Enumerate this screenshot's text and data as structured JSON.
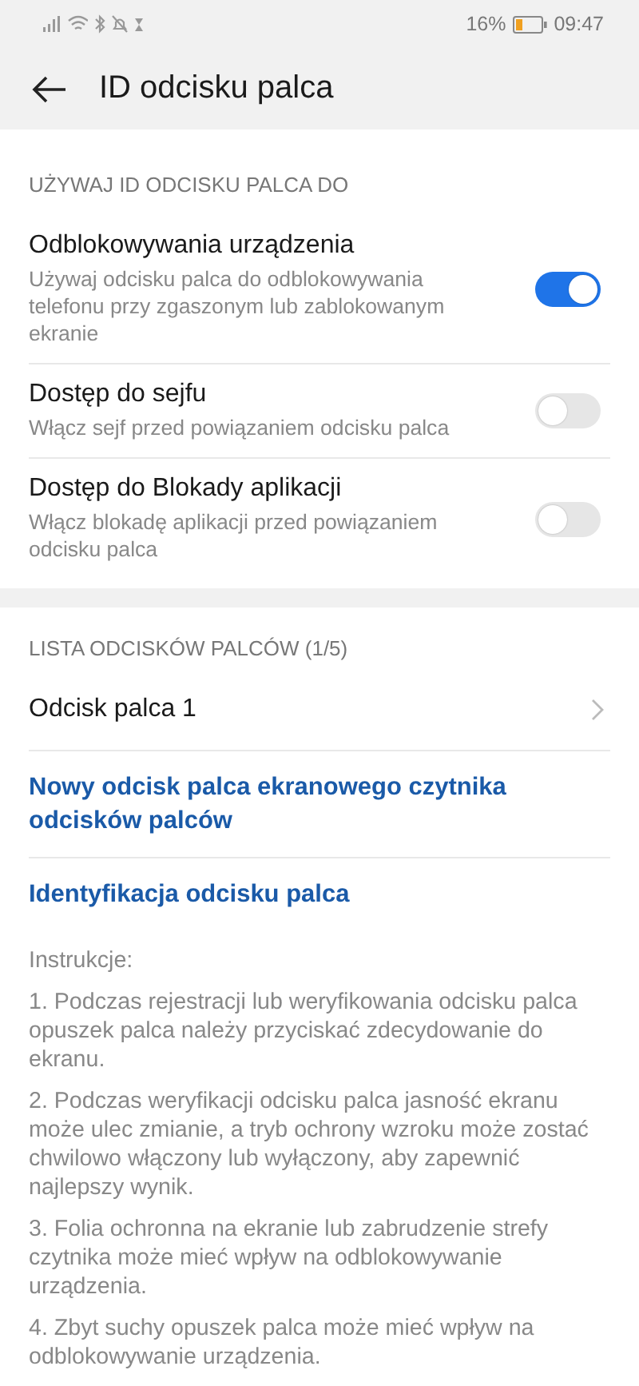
{
  "status_bar": {
    "battery_text": "16%",
    "time": "09:47"
  },
  "header": {
    "title": "ID odcisku palca"
  },
  "use_section": {
    "heading": "UŻYWAJ ID ODCISKU PALCA DO",
    "items": [
      {
        "title": "Odblokowywania urządzenia",
        "subtitle": "Używaj odcisku palca do odblokowywania telefonu przy zgaszonym lub zablokowanym ekranie",
        "on": true
      },
      {
        "title": "Dostęp do sejfu",
        "subtitle": "Włącz sejf przed powiązaniem odcisku palca",
        "on": false
      },
      {
        "title": "Dostęp do Blokady aplikacji",
        "subtitle": "Włącz blokadę aplikacji przed powiązaniem odcisku palca",
        "on": false
      }
    ]
  },
  "list_section": {
    "heading": "LISTA ODCISKÓW PALCÓW (1/5)",
    "items": [
      {
        "kind": "entry",
        "label": "Odcisk palca 1"
      },
      {
        "kind": "action",
        "label": "Nowy odcisk palca ekranowego czytnika odcisków palców"
      },
      {
        "kind": "action",
        "label": "Identyfikacja odcisku palca"
      }
    ]
  },
  "instructions": {
    "heading": "Instrukcje:",
    "paragraphs": [
      "1. Podczas rejestracji lub weryfikowania odcisku palca opuszek palca należy przyciskać zdecydowanie do ekranu.",
      "2. Podczas weryfikacji odcisku palca jasność ekranu może ulec zmianie, a tryb ochrony wzroku może zostać chwilowo włączony lub wyłączony, aby zapewnić najlepszy wynik.",
      "3. Folia ochronna na ekranie lub zabrudzenie strefy czytnika może mieć wpływ na odblokowywanie urządzenia.",
      "4. Zbyt suchy opuszek palca może mieć wpływ na odblokowywanie urządzenia."
    ]
  }
}
